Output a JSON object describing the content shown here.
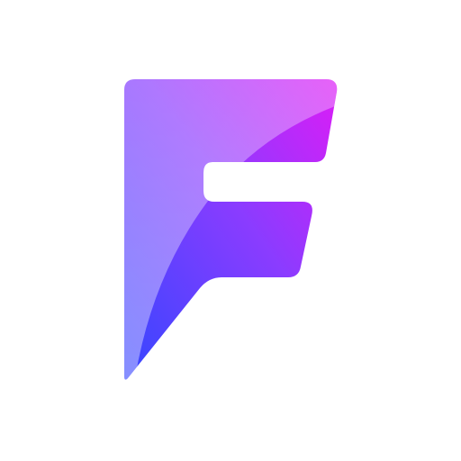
{
  "logo": {
    "letter": "F",
    "icon": "letter-f-logo-icon",
    "colors": {
      "background": "#ffffff",
      "gradient_top_right": "#dd1cf6",
      "gradient_mid": "#8a3cff",
      "gradient_bottom_left": "#3546ff",
      "highlight": "#ffffff"
    }
  }
}
